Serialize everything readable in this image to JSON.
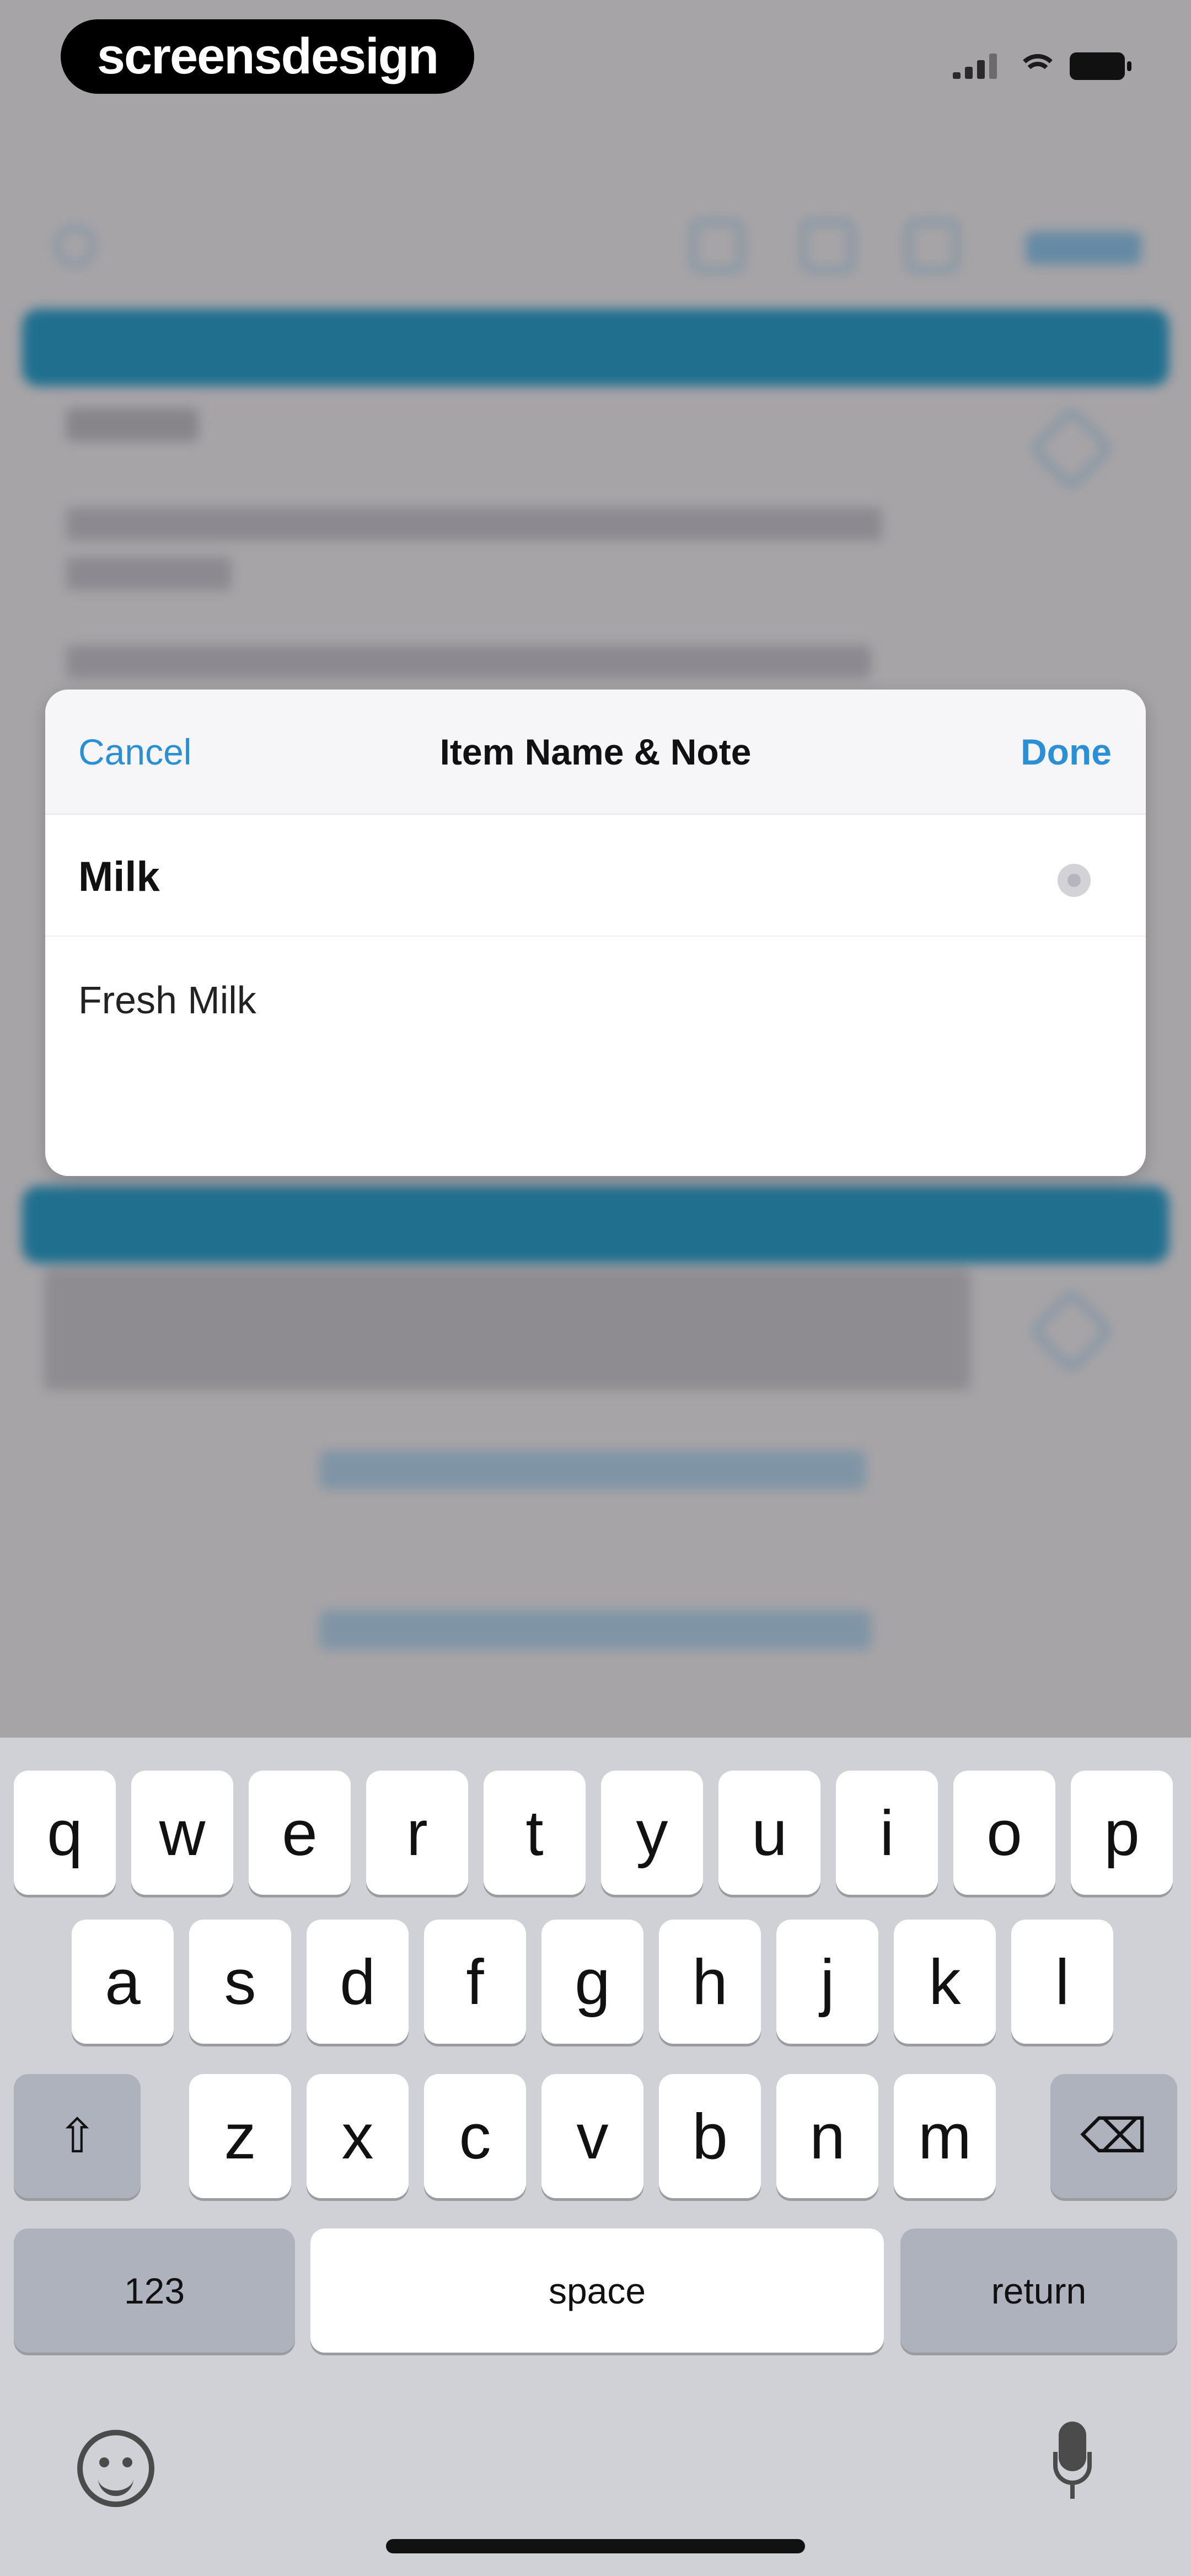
{
  "status_bar": {
    "brand": "screensdesign",
    "icons": [
      "cellular-signal-icon",
      "wifi-icon",
      "battery-icon"
    ]
  },
  "modal": {
    "cancel_label": "Cancel",
    "title": "Item Name & Note",
    "done_label": "Done",
    "name_value": "Milk",
    "note_value": "Fresh Milk"
  },
  "keyboard": {
    "row1": [
      "q",
      "w",
      "e",
      "r",
      "t",
      "y",
      "u",
      "i",
      "o",
      "p"
    ],
    "row2": [
      "a",
      "s",
      "d",
      "f",
      "g",
      "h",
      "j",
      "k",
      "l"
    ],
    "row3": [
      "z",
      "x",
      "c",
      "v",
      "b",
      "n",
      "m"
    ],
    "numbers_label": "123",
    "space_label": "space",
    "return_label": "return",
    "shift_glyph": "⇧",
    "delete_glyph": "⌫"
  },
  "colors": {
    "accent": "#2b8fd6",
    "overlay_bar": "#206f8f",
    "keyboard_bg": "#cfd1d6"
  }
}
